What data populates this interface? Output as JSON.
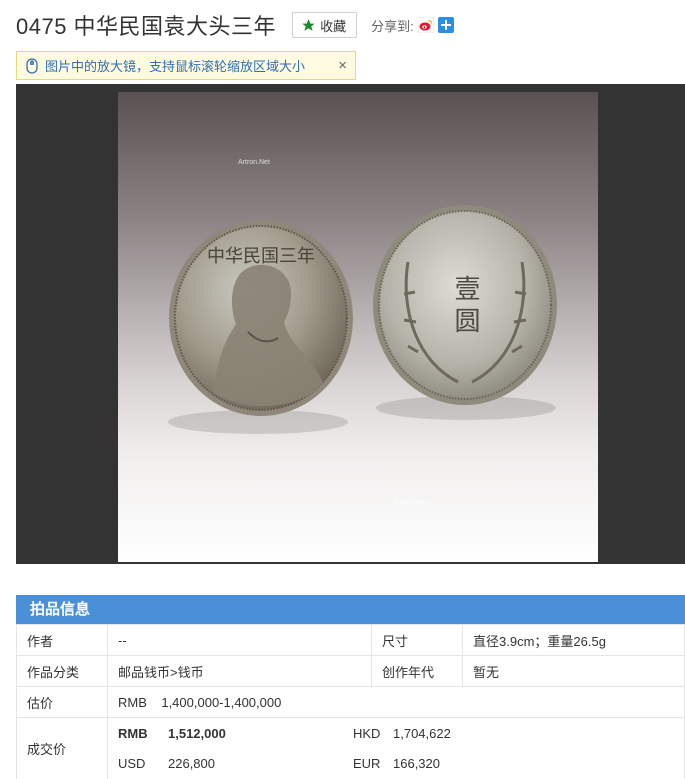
{
  "header": {
    "title": "0475 中华民国袁大头三年",
    "favorite_label": "收藏",
    "share_label": "分享到:"
  },
  "hint": {
    "text": "图片中的放大镜，支持鼠标滚轮缩放区域大小",
    "close": "×"
  },
  "image": {
    "watermark": "Artron.Net",
    "coin_front_legend": "中华民国三年",
    "coin_back_legend": "壹圆"
  },
  "info": {
    "section_title": "拍品信息",
    "rows": {
      "author_label": "作者",
      "author_value": "--",
      "size_label": "尺寸",
      "size_value": "直径3.9cm；重量26.5g",
      "category_label": "作品分类",
      "category_value": "邮品钱币>钱币",
      "era_label": "创作年代",
      "era_value": "暂无",
      "estimate_label": "估价",
      "estimate_currency": "RMB",
      "estimate_value": "1,400,000-1,400,000",
      "price_label": "成交价",
      "rmb_currency": "RMB",
      "rmb_value": "1,512,000",
      "hkd_currency": "HKD",
      "hkd_value": "1,704,622",
      "usd_currency": "USD",
      "usd_value": "226,800",
      "eur_currency": "EUR",
      "eur_value": "166,320"
    }
  },
  "colors": {
    "accent_blue": "#4a90d9",
    "price_red": "#d91b1b",
    "star_green": "#1a8a2a",
    "viewer_bg": "#333333",
    "hint_bg": "#fffbe0"
  }
}
